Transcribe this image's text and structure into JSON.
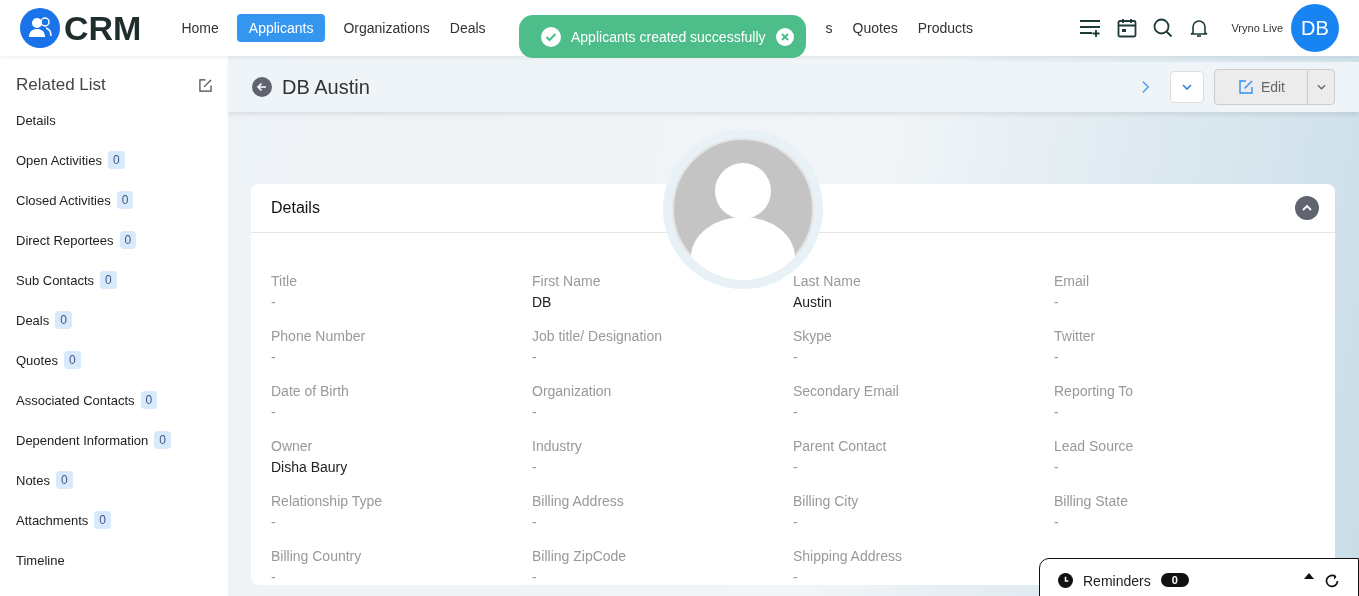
{
  "brand": {
    "name": "CRM"
  },
  "nav": [
    {
      "label": "Home",
      "selected": false
    },
    {
      "label": "Applicants",
      "selected": true
    },
    {
      "label": "Organizations",
      "selected": false
    },
    {
      "label": "Deals",
      "selected": false
    },
    {
      "label": "s",
      "selected": false
    },
    {
      "label": "Quotes",
      "selected": false
    },
    {
      "label": "Products",
      "selected": false
    }
  ],
  "toast": {
    "message": "Applicants created successfully"
  },
  "account": {
    "name": "Vryno Live",
    "initials": "DB"
  },
  "sidebar": {
    "title": "Related List",
    "items": [
      {
        "label": "Details"
      },
      {
        "label": "Open Activities",
        "count": "0"
      },
      {
        "label": "Closed Activities",
        "count": "0"
      },
      {
        "label": "Direct Reportees",
        "count": "0"
      },
      {
        "label": "Sub Contacts",
        "count": "0"
      },
      {
        "label": "Deals",
        "count": "0"
      },
      {
        "label": "Quotes",
        "count": "0"
      },
      {
        "label": "Associated Contacts",
        "count": "0"
      },
      {
        "label": "Dependent Information",
        "count": "0"
      },
      {
        "label": "Notes",
        "count": "0"
      },
      {
        "label": "Attachments",
        "count": "0"
      },
      {
        "label": "Timeline"
      }
    ]
  },
  "record": {
    "title": "DB Austin",
    "edit_label": "Edit"
  },
  "details": {
    "title": "Details",
    "expanded": true,
    "fields": [
      {
        "label": "Title",
        "value": "-"
      },
      {
        "label": "First Name",
        "value": "DB"
      },
      {
        "label": "Last Name",
        "value": "Austin"
      },
      {
        "label": "Email",
        "value": "-"
      },
      {
        "label": "Phone Number",
        "value": "-"
      },
      {
        "label": "Job title/ Designation",
        "value": "-"
      },
      {
        "label": "Skype",
        "value": "-"
      },
      {
        "label": "Twitter",
        "value": "-"
      },
      {
        "label": "Date of Birth",
        "value": "-"
      },
      {
        "label": "Organization",
        "value": "-"
      },
      {
        "label": "Secondary Email",
        "value": "-"
      },
      {
        "label": "Reporting To",
        "value": "-"
      },
      {
        "label": "Owner",
        "value": "Disha Baury"
      },
      {
        "label": "Industry",
        "value": "-"
      },
      {
        "label": "Parent Contact",
        "value": "-"
      },
      {
        "label": "Lead Source",
        "value": "-"
      },
      {
        "label": "Relationship Type",
        "value": "-"
      },
      {
        "label": "Billing Address",
        "value": "-"
      },
      {
        "label": "Billing City",
        "value": "-"
      },
      {
        "label": "Billing State",
        "value": "-"
      },
      {
        "label": "Billing Country",
        "value": "-"
      },
      {
        "label": "Billing ZipCode",
        "value": "-"
      },
      {
        "label": "Shipping Address",
        "value": "-"
      }
    ]
  },
  "reminders": {
    "label": "Reminders",
    "count": "0"
  }
}
